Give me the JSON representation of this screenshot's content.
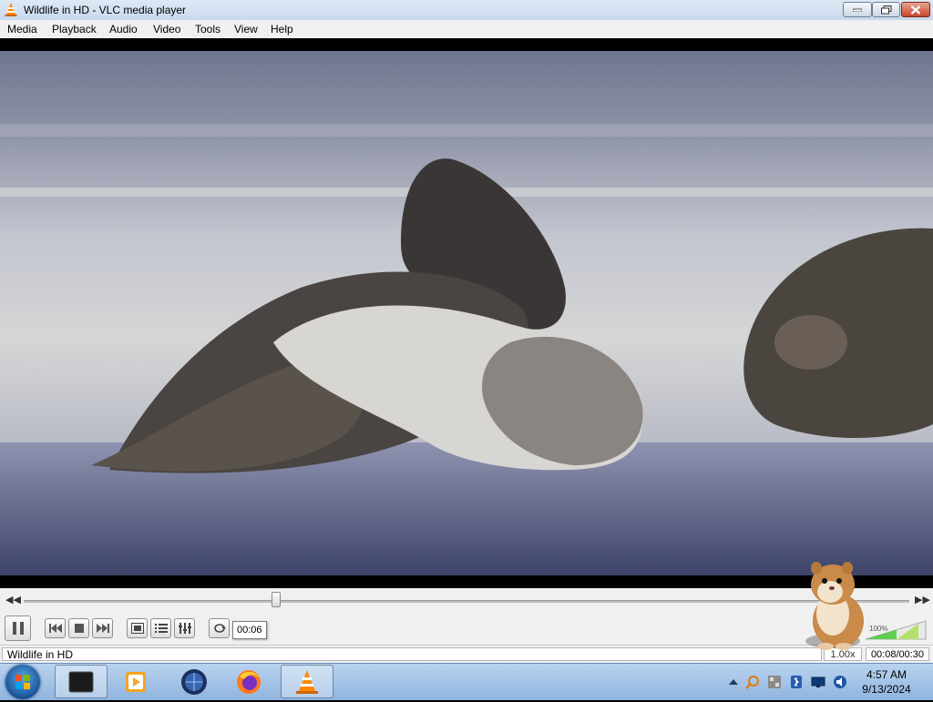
{
  "window": {
    "title": "Wildlife in HD - VLC media player"
  },
  "menu": {
    "items": [
      "Media",
      "Playback",
      "Audio",
      "Video",
      "Tools",
      "View",
      "Help"
    ]
  },
  "player": {
    "seek_position_fraction": 0.28,
    "tooltip_time": "00:06",
    "volume_percent": "100%",
    "volume_fraction": 1.0
  },
  "status": {
    "media_title": "Wildlife in HD",
    "speed": "1.00x",
    "time": "00:08/00:30"
  },
  "taskbar": {
    "apps": [
      "terminal-app",
      "media-app",
      "browser-globe-app",
      "firefox-app",
      "vlc-app"
    ],
    "clock_time": "4:57 AM",
    "clock_date": "9/13/2024"
  },
  "colors": {
    "vlc_orange": "#ff8800",
    "window_chrome": "#f0f0f0",
    "close_red": "#c8452b"
  }
}
